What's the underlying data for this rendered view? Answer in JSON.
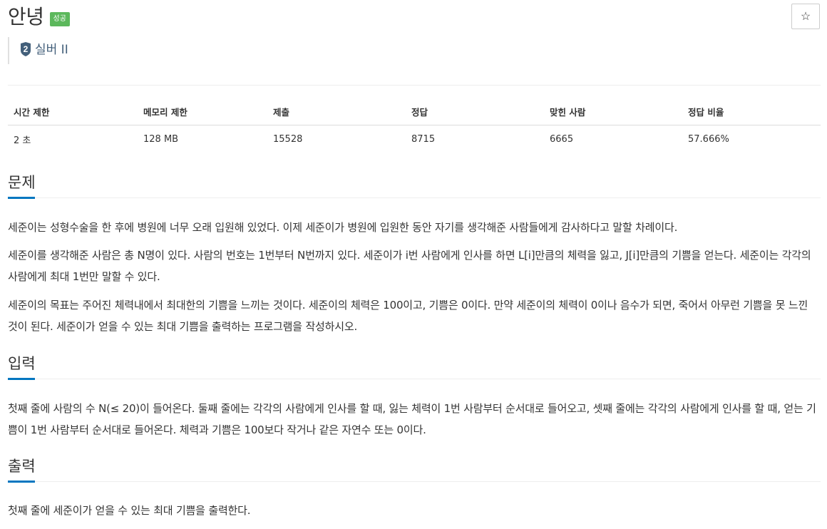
{
  "problem": {
    "title": "안녕",
    "status_badge": "성공",
    "star_label": "☆",
    "tier": {
      "number": "2",
      "label": "실버 II"
    }
  },
  "info_table": {
    "headers": [
      "시간 제한",
      "메모리 제한",
      "제출",
      "정답",
      "맞힌 사람",
      "정답 비율"
    ],
    "values": [
      "2 초",
      "128 MB",
      "15528",
      "8715",
      "6665",
      "57.666%"
    ]
  },
  "sections": {
    "description": {
      "heading": "문제",
      "paragraphs": [
        "세준이는 성형수술을 한 후에 병원에 너무 오래 입원해 있었다. 이제 세준이가 병원에 입원한 동안 자기를 생각해준 사람들에게 감사하다고 말할 차례이다.",
        "세준이를 생각해준 사람은 총 N명이 있다. 사람의 번호는 1번부터 N번까지 있다. 세준이가 i번 사람에게 인사를 하면 L[i]만큼의 체력을 잃고, J[i]만큼의 기쁨을 얻는다. 세준이는 각각의 사람에게 최대 1번만 말할 수 있다.",
        "세준이의 목표는 주어진 체력내에서 최대한의 기쁨을 느끼는 것이다. 세준이의 체력은 100이고, 기쁨은 0이다. 만약 세준이의 체력이 0이나 음수가 되면, 죽어서 아무런 기쁨을 못 느낀 것이 된다. 세준이가 얻을 수 있는 최대 기쁨을 출력하는 프로그램을 작성하시오."
      ]
    },
    "input": {
      "heading": "입력",
      "paragraphs": [
        "첫째 줄에 사람의 수 N(≤ 20)이 들어온다. 둘째 줄에는 각각의 사람에게 인사를 할 때, 잃는 체력이 1번 사람부터 순서대로 들어오고, 셋째 줄에는 각각의 사람에게 인사를 할 때, 얻는 기쁨이 1번 사람부터 순서대로 들어온다. 체력과 기쁨은 100보다 작거나 같은 자연수 또는 0이다."
      ]
    },
    "output": {
      "heading": "출력",
      "paragraphs": [
        "첫째 줄에 세준이가 얻을 수 있는 최대 기쁨을 출력한다."
      ]
    }
  },
  "colors": {
    "badge_success": "#5cb85c",
    "tier_silver": "#435f7a",
    "section_accent": "#0076c0"
  }
}
